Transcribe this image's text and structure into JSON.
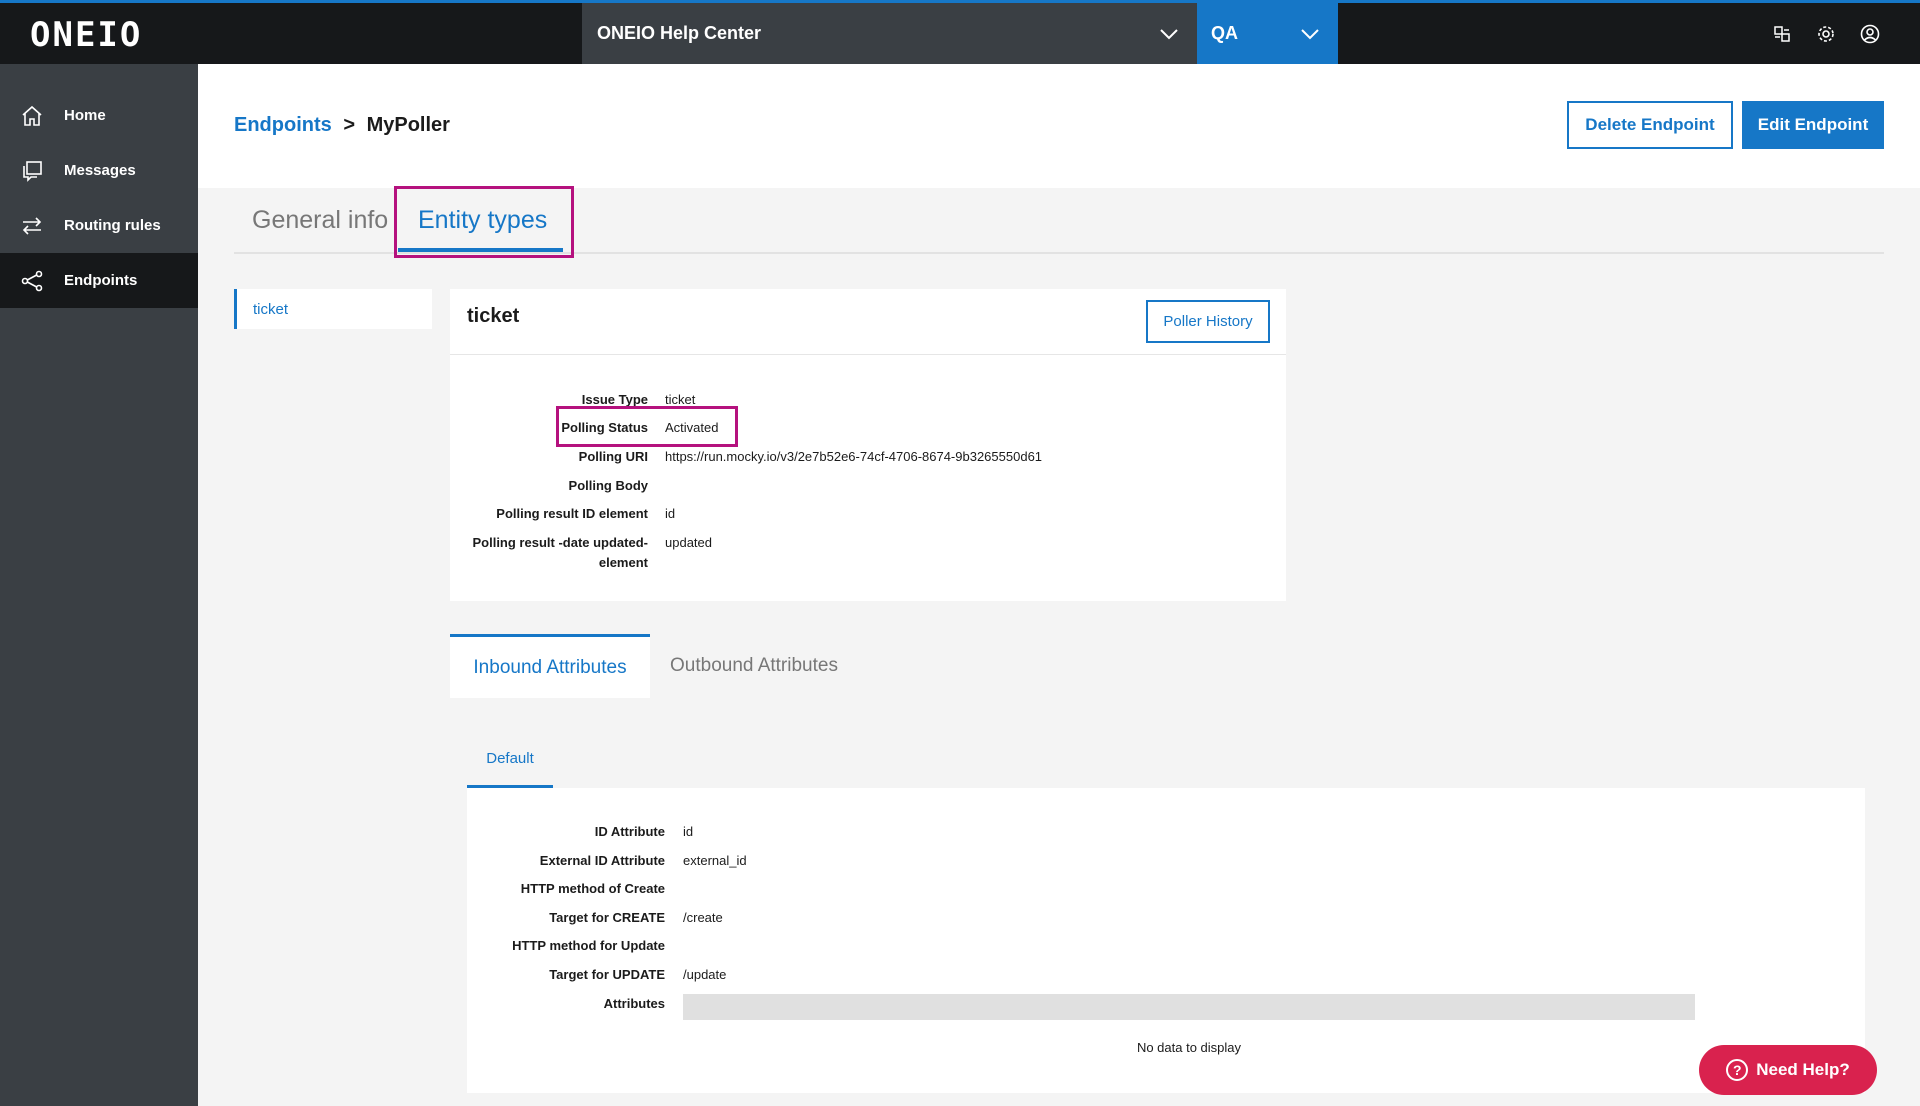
{
  "topbar": {
    "logo": "ONEIO",
    "help_center": "ONEIO Help Center",
    "environment": "QA",
    "icons": [
      "apps-icon",
      "gear-icon",
      "user-circle-icon"
    ]
  },
  "sidebar": {
    "items": [
      {
        "label": "Home",
        "icon": "home-icon"
      },
      {
        "label": "Messages",
        "icon": "messages-icon"
      },
      {
        "label": "Routing rules",
        "icon": "routing-icon"
      },
      {
        "label": "Endpoints",
        "icon": "endpoints-icon",
        "active": true
      }
    ]
  },
  "header": {
    "breadcrumb_link": "Endpoints",
    "breadcrumb_sep": ">",
    "breadcrumb_current": "MyPoller",
    "delete_label": "Delete Endpoint",
    "edit_label": "Edit Endpoint"
  },
  "main_tabs": {
    "general": "General info",
    "entity_types": "Entity types"
  },
  "entity_list": [
    "ticket"
  ],
  "entity_card": {
    "title": "ticket",
    "history_button": "Poller History",
    "fields": [
      {
        "key": "Issue Type",
        "value": "ticket"
      },
      {
        "key": "Polling Status",
        "value": "Activated"
      },
      {
        "key": "Polling URI",
        "value": "https://run.mocky.io/v3/2e7b52e6-74cf-4706-8674-9b3265550d61"
      },
      {
        "key": "Polling Body",
        "value": ""
      },
      {
        "key": "Polling result ID element",
        "value": "id"
      },
      {
        "key": "Polling result -date updated-",
        "key2": "element",
        "value": "updated"
      }
    ]
  },
  "attribute_tabs": {
    "inbound": "Inbound Attributes",
    "outbound": "Outbound Attributes",
    "sub_default": "Default"
  },
  "attributes": {
    "fields": [
      {
        "key": "ID Attribute",
        "value": "id"
      },
      {
        "key": "External ID Attribute",
        "value": "external_id"
      },
      {
        "key": "HTTP method of Create",
        "value": ""
      },
      {
        "key": "Target for CREATE",
        "value": "/create"
      },
      {
        "key": "HTTP method for Update",
        "value": ""
      },
      {
        "key": "Target for UPDATE",
        "value": "/update"
      },
      {
        "key": "Attributes",
        "value": ""
      }
    ],
    "no_data": "No data to display"
  },
  "help_button": "Need Help?",
  "colors": {
    "accent": "#1677c7",
    "highlight": "#b5117e",
    "help": "#d9224e"
  }
}
